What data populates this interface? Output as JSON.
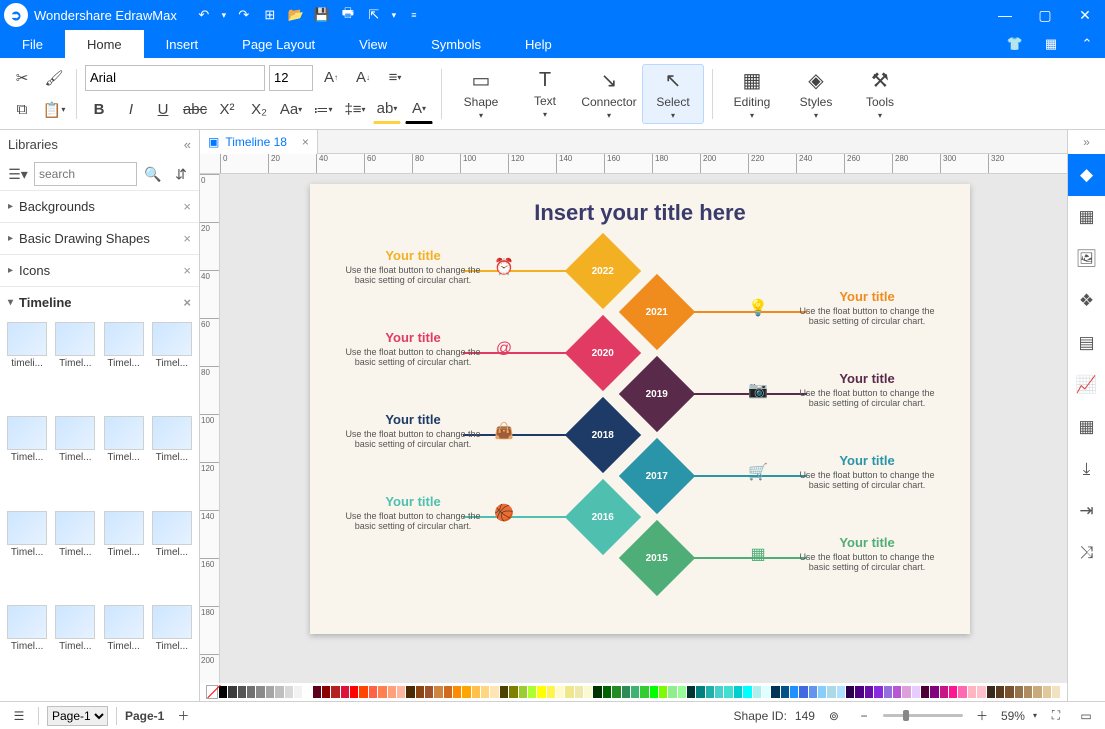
{
  "app": {
    "name": "Wondershare EdrawMax"
  },
  "menu": {
    "tabs": [
      "File",
      "Home",
      "Insert",
      "Page Layout",
      "View",
      "Symbols",
      "Help"
    ],
    "active": 1
  },
  "ribbon": {
    "font": "Arial",
    "size": "12",
    "tools": {
      "shape": "Shape",
      "text": "Text",
      "connector": "Connector",
      "select": "Select",
      "editing": "Editing",
      "styles": "Styles",
      "tools": "Tools"
    }
  },
  "libraries": {
    "title": "Libraries",
    "search_placeholder": "search",
    "categories": [
      "Backgrounds",
      "Basic Drawing Shapes",
      "Icons",
      "Timeline"
    ],
    "expanded": "Timeline",
    "thumbs": [
      "timeli...",
      "Timel...",
      "Timel...",
      "Timel...",
      "Timel...",
      "Timel...",
      "Timel...",
      "Timel...",
      "Timel...",
      "Timel...",
      "Timel...",
      "Timel...",
      "Timel...",
      "Timel...",
      "Timel...",
      "Timel..."
    ]
  },
  "doc": {
    "tab": "Timeline 18",
    "page_label": "Page-1",
    "page_current": "Page-1"
  },
  "status": {
    "shape_id_label": "Shape ID:",
    "shape_id": "149",
    "zoom": "59%"
  },
  "ruler": {
    "h": [
      "0",
      "20",
      "40",
      "60",
      "80",
      "100",
      "120",
      "140",
      "160",
      "180",
      "200",
      "220",
      "240",
      "260",
      "280",
      "300",
      "320"
    ],
    "v": [
      "0",
      "20",
      "40",
      "60",
      "80",
      "100",
      "120",
      "140",
      "160",
      "180",
      "200"
    ]
  },
  "canvas": {
    "title": "Insert your title here",
    "item_title": "Your title",
    "item_desc": "Use the float button to change the basic setting of circular chart.",
    "years": [
      "2022",
      "2021",
      "2020",
      "2019",
      "2018",
      "2017",
      "2016",
      "2015"
    ],
    "colors": [
      "#f2b022",
      "#f08b1d",
      "#e13b63",
      "#5a2a4a",
      "#1d3b66",
      "#2a94a8",
      "#4fc0b0",
      "#4fae77"
    ]
  },
  "swatches": [
    "#000000",
    "#3b3b3b",
    "#555555",
    "#707070",
    "#8a8a8a",
    "#a5a5a5",
    "#bfbfbf",
    "#d9d9d9",
    "#f2f2f2",
    "#ffffff",
    "#5d001e",
    "#8b0000",
    "#b22222",
    "#dc143c",
    "#ff0000",
    "#ff4500",
    "#ff6347",
    "#ff7f50",
    "#ffa07a",
    "#ffb6a0",
    "#4a2c00",
    "#8b4513",
    "#a0522d",
    "#cd853f",
    "#d2691e",
    "#ff8c00",
    "#ffa500",
    "#ffc04c",
    "#ffd580",
    "#ffe4b5",
    "#4d4000",
    "#808000",
    "#9acd32",
    "#adff2f",
    "#ffff00",
    "#fff44f",
    "#fffacd",
    "#f0e68c",
    "#eee8aa",
    "#fafad2",
    "#003300",
    "#006400",
    "#228b22",
    "#2e8b57",
    "#3cb371",
    "#32cd32",
    "#00ff00",
    "#7cfc00",
    "#90ee90",
    "#98fb98",
    "#003333",
    "#008080",
    "#20b2aa",
    "#48d1cc",
    "#40e0d0",
    "#00ced1",
    "#00ffff",
    "#afeeee",
    "#e0ffff",
    "#003355",
    "#005288",
    "#1e90ff",
    "#4169e1",
    "#6495ed",
    "#87cefa",
    "#add8e6",
    "#b0e0ff",
    "#2a004d",
    "#4b0082",
    "#6a0dad",
    "#8a2be2",
    "#9370db",
    "#ba55d3",
    "#dda0dd",
    "#e6ccff",
    "#4d0033",
    "#800080",
    "#c71585",
    "#ff1493",
    "#ff69b4",
    "#ffb6c1",
    "#ffc0cb",
    "#3a2a1a",
    "#5a3a20",
    "#7a5230",
    "#96744a",
    "#b08d5f",
    "#c9aa7a",
    "#e0c89a",
    "#f2e3c0"
  ]
}
